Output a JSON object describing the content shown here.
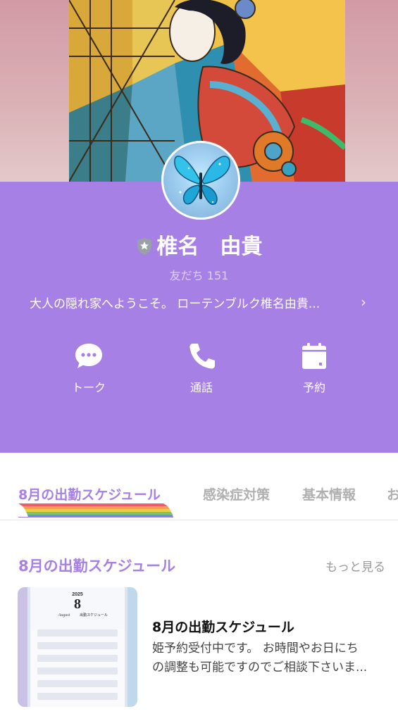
{
  "profile": {
    "name": "椎名　由貴",
    "friends": "友だち 151",
    "bio": "大人の隠れ家へようこそ。 ローテンブルク椎名由貴...",
    "bio_chevron": "›",
    "accent_color": "#a780e6"
  },
  "actions": [
    {
      "label": "トーク",
      "icon": "chat-bubble-icon"
    },
    {
      "label": "通話",
      "icon": "phone-icon"
    },
    {
      "label": "予約",
      "icon": "calendar-icon"
    }
  ],
  "tabs": [
    {
      "label": "8月の出勤スケジュール",
      "active": true
    },
    {
      "label": "感染症対策",
      "active": false
    },
    {
      "label": "基本情報",
      "active": false
    },
    {
      "label": "お",
      "active": false
    }
  ],
  "section": {
    "title": "8月の出勤スケジュール",
    "more": "もっと見る"
  },
  "card": {
    "thumb_year": "2025",
    "thumb_month": "8",
    "thumb_month_name": "August",
    "thumb_caption": "出勤スケジュール",
    "title": "8月の出勤スケジュール",
    "desc_line1": "姫予約受付中です。 お時間やお日にち",
    "desc_line2": "の調整も可能ですのでご相談下さいま..."
  }
}
